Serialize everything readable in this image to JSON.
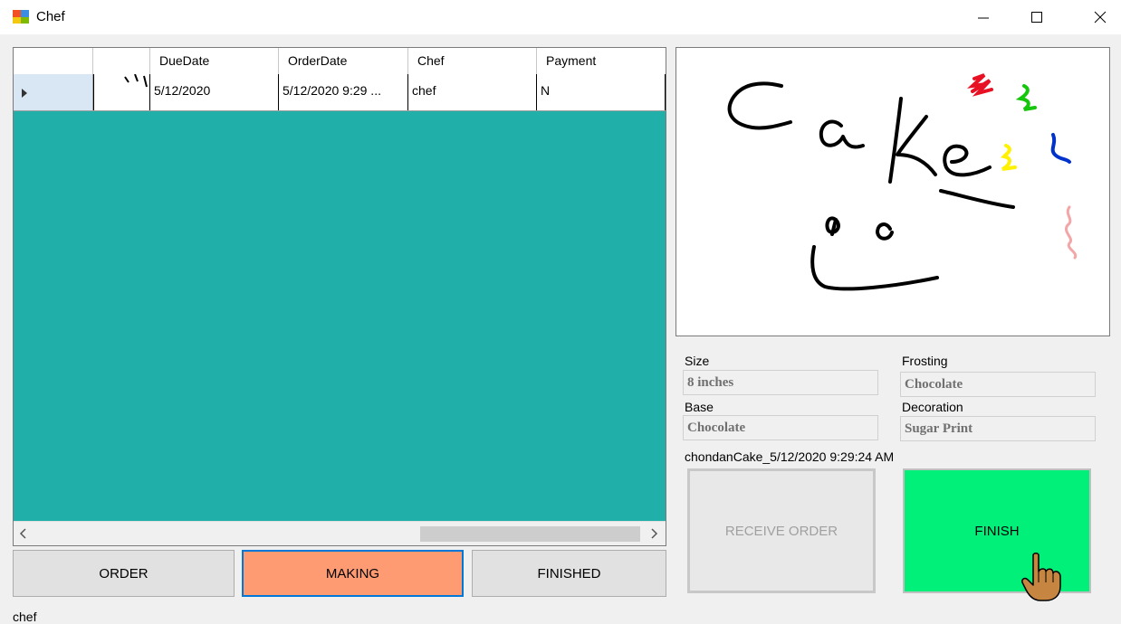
{
  "window": {
    "title": "Chef"
  },
  "grid": {
    "columns": [
      "",
      "",
      "DueDate",
      "OrderDate",
      "Chef",
      "Payment"
    ],
    "rows": [
      {
        "col2": "",
        "due": "5/12/2020",
        "order": "5/12/2020 9:29 ...",
        "chef": "chef",
        "payment": "N"
      }
    ]
  },
  "tabs": {
    "order": "ORDER",
    "making": "MAKING",
    "finished": "FINISHED"
  },
  "details": {
    "size_label": "Size",
    "size_value": "8 inches",
    "frosting_label": "Frosting",
    "frosting_value": "Chocolate",
    "base_label": "Base",
    "base_value": "Chocolate",
    "decoration_label": "Decoration",
    "decoration_value": "Sugar Print",
    "order_id": "chondanCake_5/12/2020 9:29:24 AM"
  },
  "actions": {
    "receive": "RECEIVE ORDER",
    "finish": "FINISH"
  },
  "status": {
    "user": "chef"
  },
  "colors": {
    "teal": "#20afa9",
    "making": "#ff9b72",
    "finish": "#00f07a"
  }
}
